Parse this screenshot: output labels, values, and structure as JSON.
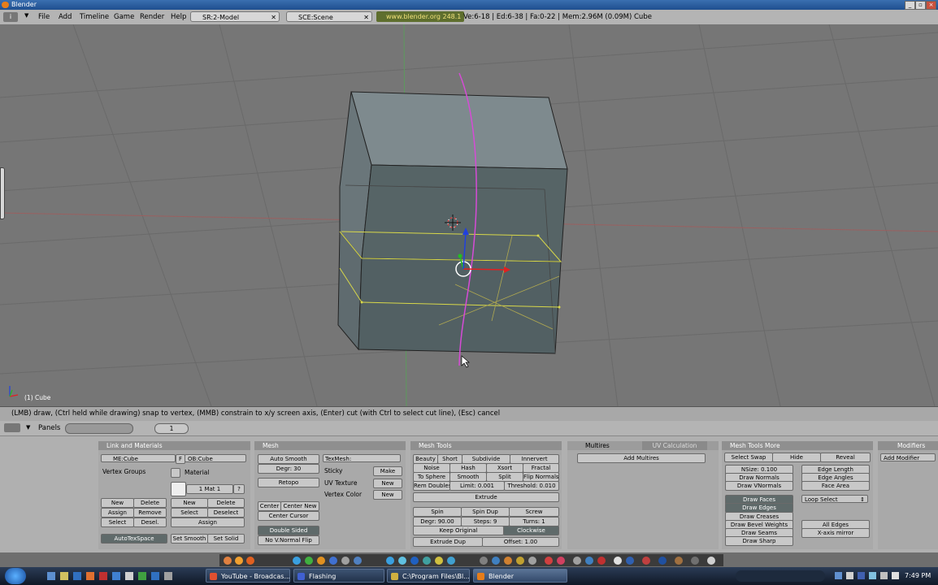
{
  "window": {
    "title": "Blender"
  },
  "menubar": {
    "menus": [
      "File",
      "Add",
      "Timeline",
      "Game",
      "Render",
      "Help"
    ],
    "screen_field": "SR:2-Model",
    "scene_field": "SCE:Scene",
    "url_badge": "www.blender.org 248.1",
    "stats": "Ve:6-18 | Ed:6-38 | Fa:0-22 | Mem:2.96M (0.09M) Cube"
  },
  "viewport": {
    "object_label": "(1) Cube"
  },
  "status": {
    "message": "(LMB) draw, (Ctrl held while drawing) snap to vertex, (MMB) constrain to x/y screen axis, (Enter) cut (with Ctrl to select cut line), (Esc) cancel"
  },
  "panels_header": {
    "label": "Panels",
    "frame": "1"
  },
  "link_materials": {
    "title": "Link and Materials",
    "me_field": "ME:Cube",
    "f_label": "F",
    "ob_field": "OB:Cube",
    "vertex_groups": "Vertex Groups",
    "material": "Material",
    "mat_field": "1 Mat 1",
    "q": "?",
    "vg_buttons": [
      "New",
      "Delete",
      "Assign",
      "Remove",
      "Select",
      "Desel."
    ],
    "mat_buttons": [
      "New",
      "Delete",
      "Select",
      "Deselect",
      "Assign"
    ],
    "autotex": "AutoTexSpace",
    "set_smooth": "Set Smooth",
    "set_solid": "Set Solid"
  },
  "mesh": {
    "title": "Mesh",
    "auto_smooth": "Auto Smooth",
    "degr": "Degr: 30",
    "retopo": "Retopo",
    "center": "Center",
    "center_new": "Center New",
    "center_cursor": "Center Cursor",
    "double_sided": "Double Sided",
    "no_vnormal": "No V.Normal Flip",
    "texmesh": "TexMesh:",
    "sticky": "Sticky",
    "make": "Make",
    "uv_texture": "UV Texture",
    "new1": "New",
    "vertex_color": "Vertex Color",
    "new2": "New"
  },
  "mesh_tools": {
    "title": "Mesh Tools",
    "row1": [
      "Beauty",
      "Short",
      "Subdivide",
      "Innervert"
    ],
    "row2": [
      "Noise",
      "Hash",
      "Xsort",
      "Fractal"
    ],
    "row3": [
      "To Sphere",
      "Smooth",
      "Split",
      "Flip Normals"
    ],
    "rem_doubles": "Rem Doubles",
    "limit": "Limit: 0.001",
    "threshold": "Threshold: 0.010",
    "extrude": "Extrude",
    "spin": "Spin",
    "spin_dup": "Spin Dup",
    "screw": "Screw",
    "degr": "Degr: 90.00",
    "steps": "Steps: 9",
    "turns": "Turns: 1",
    "keep_original": "Keep Original",
    "clockwise": "Clockwise",
    "extrude_dup": "Extrude Dup",
    "offset": "Offset: 1.00"
  },
  "multires": {
    "tab_active": "Multires",
    "tab_inactive": "UV Calculation",
    "add_multires": "Add Multires"
  },
  "mesh_tools_more": {
    "title": "Mesh Tools More",
    "select_swap": "Select Swap",
    "hide": "Hide",
    "reveal": "Reveal",
    "nsize": "NSize: 0.100",
    "draw_normals": "Draw Normals",
    "draw_vnormals": "Draw VNormals",
    "edge_length": "Edge Length",
    "edge_angles": "Edge Angles",
    "face_area": "Face Area",
    "draw_faces": "Draw Faces",
    "draw_edges": "Draw Edges",
    "draw_creases": "Draw Creases",
    "draw_bevel": "Draw Bevel Weights",
    "draw_seams": "Draw Seams",
    "draw_sharp": "Draw Sharp",
    "loop_select": "Loop Select",
    "all_edges": "All Edges",
    "xaxis_mirror": "X-axis mirror"
  },
  "modifiers": {
    "title": "Modifiers",
    "add_modifier": "Add Modifier"
  },
  "taskbar": {
    "tasks": [
      "YouTube - Broadcas...",
      "Flashing",
      "C:\\Program Files\\Bl...",
      "Blender"
    ],
    "clock": "7:49 PM"
  },
  "colors": {
    "viewport_bg": "#767676",
    "cube_face": "#5a6a6c",
    "selection": "#d8d84a",
    "knife_line": "#d64bd6",
    "x_axis": "#e02020",
    "y_axis": "#20c020",
    "z_axis": "#2040e0"
  }
}
